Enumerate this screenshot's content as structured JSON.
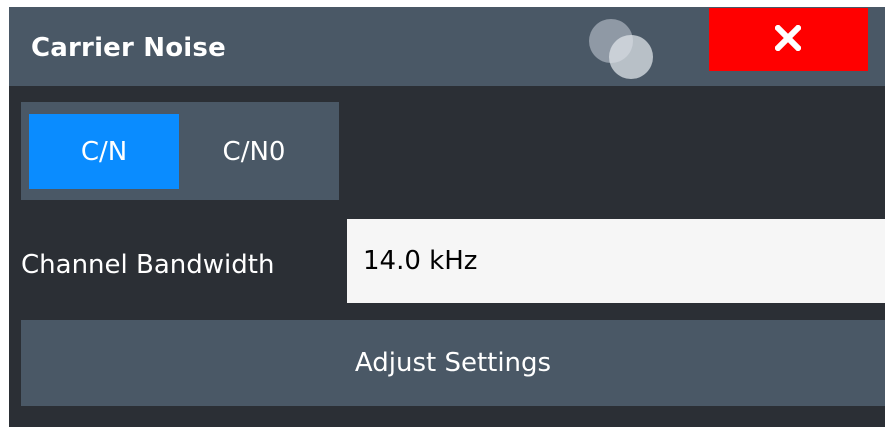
{
  "dialog": {
    "title": "Carrier Noise",
    "close_label": "X"
  },
  "mode": {
    "options": [
      "C/N",
      "C/N0"
    ],
    "selected": "C/N"
  },
  "channel_bandwidth": {
    "label": "Channel Bandwidth",
    "value": "14.0 kHz"
  },
  "adjust_settings_label": "Adjust Settings",
  "colors": {
    "accent": "#0a8cff",
    "close_button": "#ff0000",
    "panel": "#4a5866",
    "background": "#2b2f35"
  },
  "icons": {
    "move": "move-handle-icon",
    "close": "close-icon"
  }
}
